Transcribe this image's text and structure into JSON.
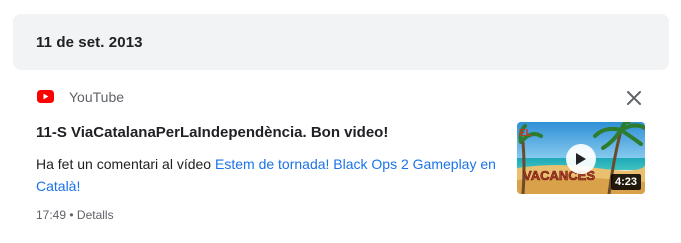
{
  "date_header": "11 de set. 2013",
  "activity": {
    "source": {
      "name": "YouTube",
      "icon": "youtube-logo-icon",
      "brand_color": "#ff0000"
    },
    "title": "11-S ViaCatalanaPerLaIndependència. Bon video!",
    "description_prefix": "Ha fet un comentari al vídeo ",
    "video_link": "Estem de tornada! Black Ops 2 Gameplay en Català!",
    "time": "17:49",
    "separator": "•",
    "details_link": "Detalls",
    "thumbnail": {
      "duration": "4:23",
      "overlay_text": "VACANCES",
      "icon": "play-icon"
    },
    "close_icon": "close-icon"
  },
  "colors": {
    "link": "#1a73e8",
    "muted": "#5f6368",
    "date_bar_bg": "#f1f3f4"
  }
}
